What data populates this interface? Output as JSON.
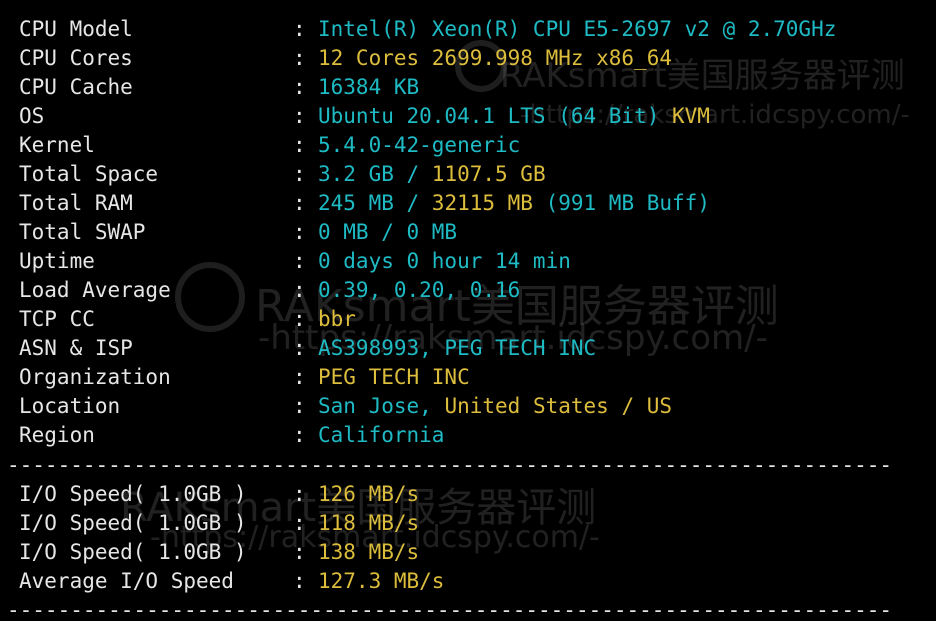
{
  "info_rows": [
    {
      "label": "CPU Model",
      "parts": [
        {
          "text": "Intel(R) Xeon(R) CPU E5-2697 v2 @ 2.70GHz",
          "color": "cyan"
        }
      ]
    },
    {
      "label": "CPU Cores",
      "parts": [
        {
          "text": "12 Cores 2699.998 MHz x86_64",
          "color": "yellow"
        }
      ]
    },
    {
      "label": "CPU Cache",
      "parts": [
        {
          "text": "16384 KB",
          "color": "cyan"
        }
      ]
    },
    {
      "label": "OS",
      "parts": [
        {
          "text": "Ubuntu 20.04.1 LTS (64 Bit) ",
          "color": "cyan"
        },
        {
          "text": "KVM",
          "color": "yellow"
        }
      ]
    },
    {
      "label": "Kernel",
      "parts": [
        {
          "text": "5.4.0-42-generic",
          "color": "cyan"
        }
      ]
    },
    {
      "label": "Total Space",
      "parts": [
        {
          "text": "3.2 GB / ",
          "color": "cyan"
        },
        {
          "text": "1107.5 GB",
          "color": "yellow"
        }
      ]
    },
    {
      "label": "Total RAM",
      "parts": [
        {
          "text": "245 MB / ",
          "color": "cyan"
        },
        {
          "text": "32115 MB",
          "color": "yellow"
        },
        {
          "text": " (991 MB Buff)",
          "color": "cyan"
        }
      ]
    },
    {
      "label": "Total SWAP",
      "parts": [
        {
          "text": "0 MB / 0 MB",
          "color": "cyan"
        }
      ]
    },
    {
      "label": "Uptime",
      "parts": [
        {
          "text": "0 days 0 hour 14 min",
          "color": "cyan"
        }
      ]
    },
    {
      "label": "Load Average",
      "parts": [
        {
          "text": "0.39, 0.20, 0.16",
          "color": "cyan"
        }
      ]
    },
    {
      "label": "TCP CC",
      "parts": [
        {
          "text": "bbr",
          "color": "yellow"
        }
      ]
    },
    {
      "label": "ASN & ISP",
      "parts": [
        {
          "text": "AS398993, PEG TECH INC",
          "color": "cyan"
        }
      ]
    },
    {
      "label": "Organization",
      "parts": [
        {
          "text": "PEG TECH INC",
          "color": "yellow"
        }
      ]
    },
    {
      "label": "Location",
      "parts": [
        {
          "text": "San Jose, ",
          "color": "cyan"
        },
        {
          "text": "United States / US",
          "color": "yellow"
        }
      ]
    },
    {
      "label": "Region",
      "parts": [
        {
          "text": "California",
          "color": "cyan"
        }
      ]
    }
  ],
  "io_rows": [
    {
      "label": "I/O Speed( 1.0GB )",
      "parts": [
        {
          "text": "126 MB/s",
          "color": "yellow"
        }
      ]
    },
    {
      "label": "I/O Speed( 1.0GB )",
      "parts": [
        {
          "text": "118 MB/s",
          "color": "yellow"
        }
      ]
    },
    {
      "label": "I/O Speed( 1.0GB )",
      "parts": [
        {
          "text": "138 MB/s",
          "color": "yellow"
        }
      ]
    },
    {
      "label": "Average I/O Speed",
      "parts": [
        {
          "text": "127.3 MB/s",
          "color": "yellow"
        }
      ]
    }
  ],
  "colon": ":",
  "separator": "----------------------------------------------------------------------",
  "watermark": {
    "brand": "RAKsmart美国服务器评测",
    "url": "-https://raksmart.idcspy.com/-"
  },
  "colors": {
    "background": "#000000",
    "label": "#e6e6e6",
    "cyan": "#1ebbc5",
    "yellow": "#dcbd3c"
  }
}
